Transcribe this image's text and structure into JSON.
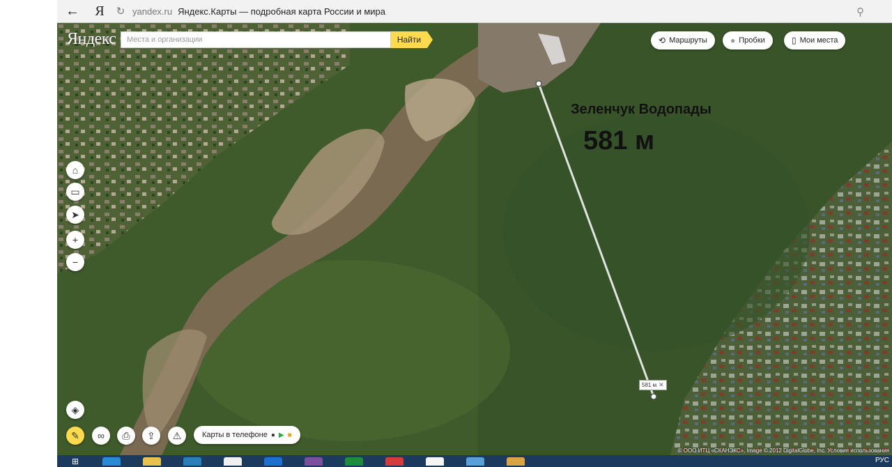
{
  "browser": {
    "back_icon": "arrow-left-icon",
    "site_logo": "Я",
    "reload_icon": "reload-icon",
    "domain": "yandex.ru",
    "page_title": "Яндекс.Карты — подробная карта России и мира",
    "search_icon": "search-icon"
  },
  "map": {
    "logo": "Яндекс",
    "search_placeholder": "Места и организации",
    "find_label": "Найти",
    "toolbar": {
      "routes_label": "Маршруты",
      "traffic_label": "Пробки",
      "my_places_label": "Мои места"
    },
    "controls": [
      "home-icon",
      "briefcase-icon",
      "location-arrow-icon",
      "zoom-in-icon",
      "zoom-out-icon",
      "layers-icon"
    ],
    "bottom_tools": [
      "ruler-icon",
      "binoculars-icon",
      "printer-icon",
      "share-icon",
      "warning-icon"
    ],
    "phone_maps_label": "Карты в телефоне",
    "annotation_title": "Зеленчук Водопады",
    "annotation_distance": "581 м",
    "ruler_label": "581 м",
    "copyright": "© ООО ИТЦ «СКАНЭКС», Image © 2012 DigitalGlobe, Inc. Условия использования",
    "colors": {
      "accent_yellow": "#ffdb4d",
      "forest": "#3e5b2a",
      "river": "#7a6a52"
    }
  },
  "taskbar": {
    "items": [
      "windows-start-icon",
      "internet-explorer-icon",
      "file-explorer-icon",
      "app-icon",
      "app-icon",
      "app-icon",
      "viber-icon",
      "store-icon",
      "app-icon",
      "yandex-browser-icon",
      "app-icon",
      "paint-icon"
    ],
    "tray_language": "РУС",
    "colors": {
      "background": "#1b3a5c"
    }
  }
}
